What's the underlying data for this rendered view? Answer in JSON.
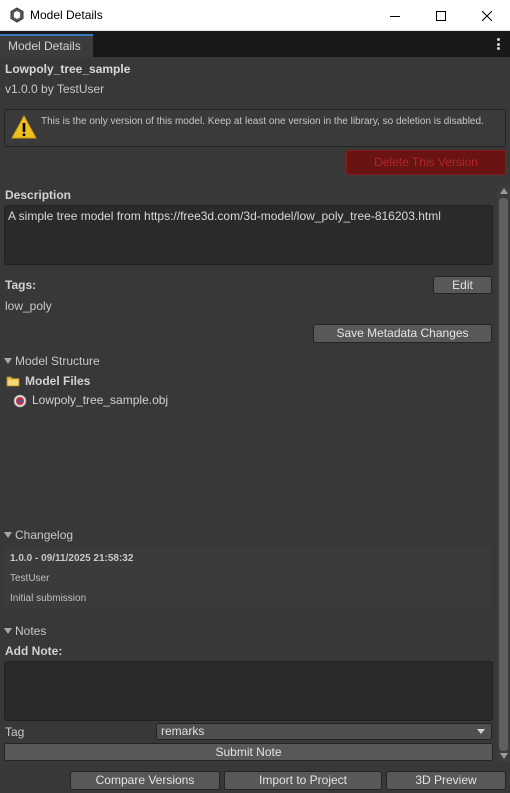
{
  "window": {
    "title": "Model Details"
  },
  "tab": {
    "label": "Model Details"
  },
  "model": {
    "name": "Lowpoly_tree_sample",
    "version_line": "v1.0.0 by TestUser"
  },
  "warning": {
    "text": "This is the only version of this model. Keep at least one version in the library, so deletion is disabled."
  },
  "delete_button": "Delete This Version",
  "description": {
    "label": "Description",
    "value": "A simple tree model from https://free3d.com/3d-model/low_poly_tree-816203.html"
  },
  "tags": {
    "label": "Tags:",
    "edit_button": "Edit",
    "value": "low_poly"
  },
  "save_metadata_button": "Save Metadata Changes",
  "structure": {
    "label": "Model Structure",
    "folder": "Model Files",
    "files": [
      "Lowpoly_tree_sample.obj"
    ]
  },
  "changelog": {
    "label": "Changelog",
    "entry": {
      "header": "1.0.0 - 09/11/2025 21:58:32",
      "author": "TestUser",
      "message": "Initial submission"
    }
  },
  "notes": {
    "label": "Notes",
    "add_note_label": "Add Note:",
    "note_value": "",
    "tag_label": "Tag",
    "tag_selected": "remarks",
    "submit_button": "Submit Note"
  },
  "footer": {
    "compare_button": "Compare Versions",
    "import_button": "Import to Project",
    "preview_button": "3D Preview"
  },
  "colors": {
    "background": "#383838",
    "tab_accent": "#3a79bb",
    "danger": "#691313",
    "warning_icon": "#f0c020"
  }
}
